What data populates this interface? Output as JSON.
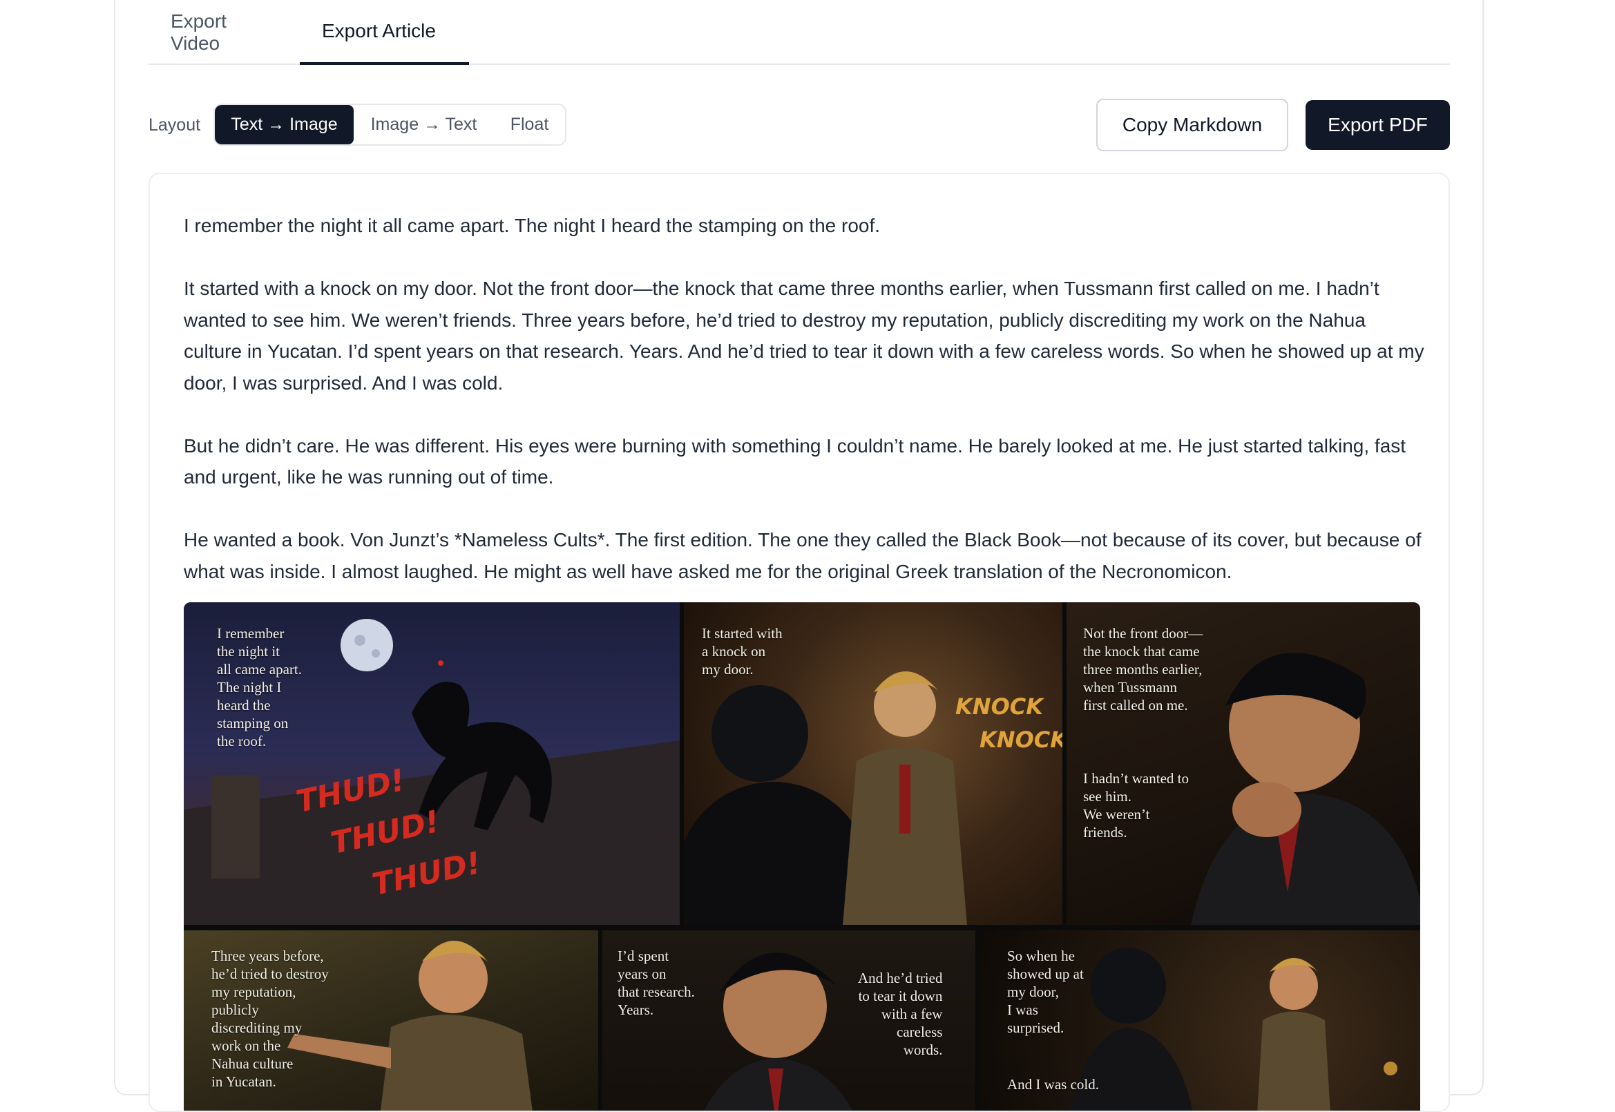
{
  "tabs": [
    {
      "label": "Export Video"
    },
    {
      "label": "Export Article"
    }
  ],
  "toolbar": {
    "layout_label": "Layout",
    "layout_options": [
      "Text → Image",
      "Image → Text",
      "Float"
    ],
    "selected_layout": "Text → Image",
    "copy_markdown_label": "Copy Markdown",
    "export_pdf_label": "Export PDF"
  },
  "article": {
    "paragraphs": [
      "I remember the night it all came apart. The night I heard the stamping on the roof.",
      "It started with a knock on my door. Not the front door—the knock that came three months earlier, when Tussmann first called on me. I hadn’t wanted to see him. We weren’t friends. Three years before, he’d tried to destroy my reputation, publicly discrediting my work on the Nahua culture in Yucatan. I’d spent years on that research. Years. And he’d tried to tear it down with a few careless words. So when he showed up at my door, I was surprised. And I was cold.",
      "But he didn’t care. He was different. His eyes were burning with something I couldn’t name. He barely looked at me. He just started talking, fast and urgent, like he was running out of time.",
      "He wanted a book. Von Junzt’s *Nameless Cults*. The first edition. The one they called the Black Book—not because of its cover, but because of what was inside. I almost laughed. He might as well have asked me for the original Greek translation of the Necronomicon."
    ]
  },
  "comic": {
    "panel1": {
      "caption": "I remember\nthe night it\nall came apart.\nThe night I\nheard the\nstamping on\nthe roof.",
      "sfx": [
        "THUD!",
        "THUD!",
        "THUD!"
      ]
    },
    "panel2": {
      "caption": "It started with\na knock on\nmy door.",
      "sfx": [
        "KNOCK",
        "KNOCK"
      ]
    },
    "panel3": {
      "caption": "Not the front door—\nthe knock that came\nthree months earlier,\nwhen Tussmann\nfirst called on me.",
      "caption2": "I hadn’t wanted to\nsee him.\nWe weren’t\nfriends."
    },
    "panel4": {
      "caption": "Three years before,\nhe’d tried to destroy\nmy reputation,\npublicly\ndiscrediting my\nwork on the\nNahua culture\nin Yucatan."
    },
    "panel5": {
      "caption": "I’d spent\nyears on\nthat research.\nYears.",
      "caption2": "And he’d tried\nto tear it down\nwith a few\ncareless\nwords."
    },
    "panel6": {
      "caption": "So when he\nshowed up at\nmy door,\nI was\nsurprised.",
      "caption2": "And I was cold."
    }
  },
  "colors": {
    "accent": "#111827",
    "sfx_red": "#d42a1f",
    "sfx_gold": "#e0a43a"
  }
}
